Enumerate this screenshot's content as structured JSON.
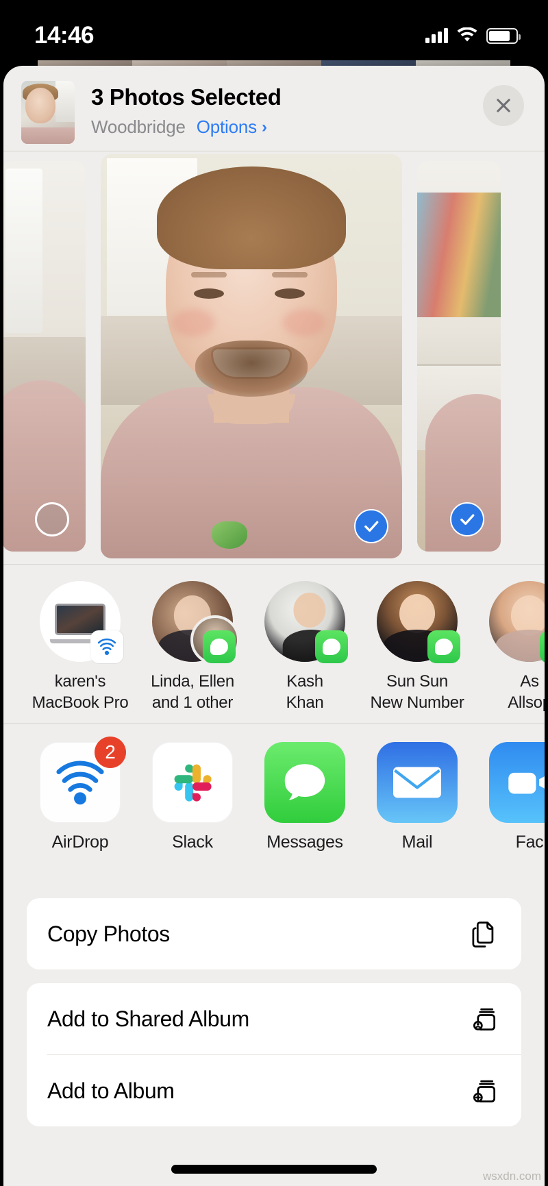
{
  "status_bar": {
    "time": "14:46",
    "signal_icon": "cellular-bars-icon",
    "wifi_icon": "wifi-icon",
    "battery_icon": "battery-icon"
  },
  "share_sheet": {
    "header": {
      "title": "3 Photos Selected",
      "subject": "Woodbridge",
      "options_label": "Options",
      "options_chevron": "chevron-right-icon",
      "close_icon": "close-icon",
      "thumbnail_name": "selected-photo-thumbnail"
    },
    "carousel": {
      "photos": [
        {
          "alt": "photo-left-partial",
          "selected": false,
          "check_icon": "circle-empty-icon"
        },
        {
          "alt": "photo-center-girl",
          "selected": true,
          "check_icon": "checkmark-circle-icon"
        },
        {
          "alt": "photo-right-partial",
          "selected": true,
          "check_icon": "checkmark-circle-icon"
        }
      ]
    },
    "contacts": [
      {
        "name_line1": "karen's",
        "name_line2": "MacBook Pro",
        "badge": "airdrop-badge-icon",
        "avatar": "macbook-pro-icon"
      },
      {
        "name_line1": "Linda, Ellen",
        "name_line2": "and 1 other",
        "badge": "messages-badge-icon",
        "avatar": "group-avatar"
      },
      {
        "name_line1": "Kash",
        "name_line2": "Khan",
        "badge": "messages-badge-icon",
        "avatar": "contact-avatar"
      },
      {
        "name_line1": "Sun Sun",
        "name_line2": "New Number",
        "badge": "messages-badge-icon",
        "avatar": "contact-avatar"
      },
      {
        "name_line1": "As",
        "name_line2": "Allsop",
        "badge": "messages-badge-icon",
        "avatar": "contact-avatar"
      }
    ],
    "apps": [
      {
        "label": "AirDrop",
        "icon": "airdrop-icon",
        "badge": "2"
      },
      {
        "label": "Slack",
        "icon": "slack-icon",
        "badge": null
      },
      {
        "label": "Messages",
        "icon": "messages-icon",
        "badge": null
      },
      {
        "label": "Mail",
        "icon": "mail-icon",
        "badge": null
      },
      {
        "label": "Fac",
        "icon": "facetime-icon",
        "badge": null
      }
    ],
    "actions": [
      {
        "label": "Copy Photos",
        "icon": "copy-documents-icon"
      },
      {
        "label": "Add to Shared Album",
        "icon": "shared-album-icon"
      },
      {
        "label": "Add to Album",
        "icon": "add-to-album-icon"
      }
    ]
  },
  "watermark": "wsxdn.com",
  "colors": {
    "accent_blue": "#2d7cf6",
    "selection_blue": "#2b76e5",
    "badge_red": "#e8412a",
    "messages_green": "#31cd3d",
    "sheet_bg": "#efeeec",
    "card_bg": "#ffffff"
  }
}
